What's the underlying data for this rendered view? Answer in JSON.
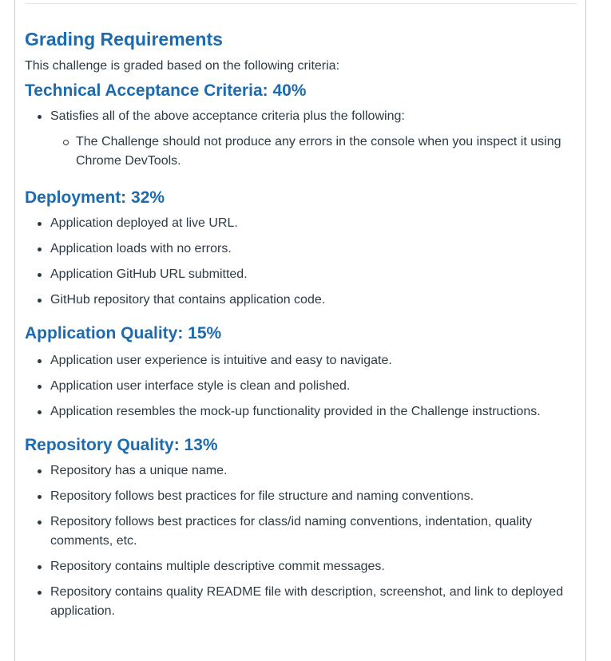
{
  "title": "Grading Requirements",
  "intro": "This challenge is graded based on the following criteria:",
  "sections": [
    {
      "heading": "Technical Acceptance Criteria: 40%",
      "items": [
        "Satisfies all of the above acceptance criteria plus the following:"
      ],
      "subitems": [
        "The Challenge should not produce any errors in the console when you inspect it using Chrome DevTools."
      ]
    },
    {
      "heading": "Deployment: 32%",
      "items": [
        "Application deployed at live URL.",
        "Application loads with no errors.",
        "Application GitHub URL submitted.",
        "GitHub repository that contains application code."
      ]
    },
    {
      "heading": "Application Quality: 15%",
      "items": [
        "Application user experience is intuitive and easy to navigate.",
        "Application user interface style is clean and polished.",
        "Application resembles the mock-up functionality provided in the Challenge instructions."
      ]
    },
    {
      "heading": "Repository Quality: 13%",
      "items": [
        "Repository has a unique name.",
        "Repository follows best practices for file structure and naming conventions.",
        "Repository follows best practices for class/id naming conventions, indentation, quality comments, etc.",
        "Repository contains multiple descriptive commit messages.",
        "Repository contains quality README file with description, screenshot, and link to deployed application."
      ]
    }
  ],
  "colors": {
    "heading": "#1c6bb0",
    "text": "#2d3b45",
    "border": "#c7cdd1"
  }
}
